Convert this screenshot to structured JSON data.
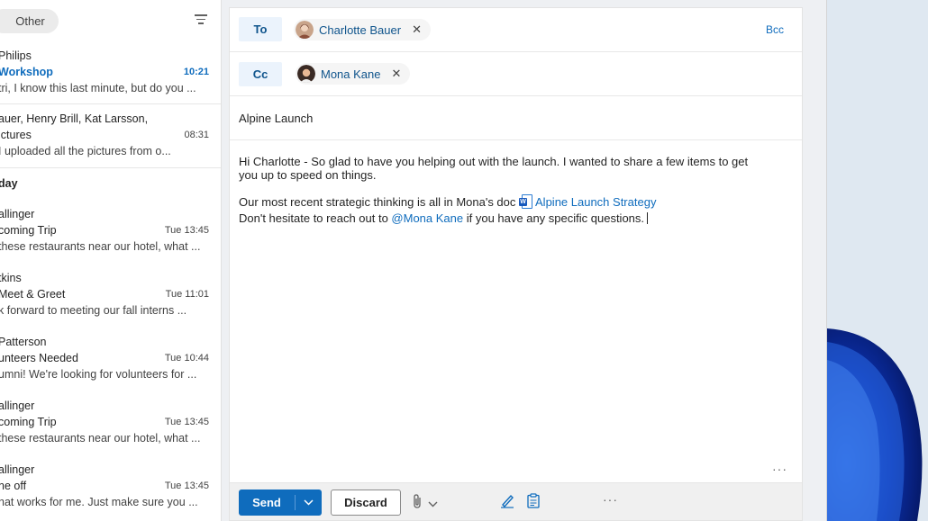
{
  "message_list": {
    "filter_tab": "Other",
    "group_header": "day",
    "messages": [
      {
        "sender": "Philips",
        "subject": "Workshop",
        "time": "10:21",
        "preview": "tri, I know this last minute, but do you ...",
        "unread": true
      },
      {
        "sender": "auer, Henry Brill, Kat Larsson,",
        "subject": "ictures",
        "time": "08:31",
        "preview": "I uploaded all the pictures from o...",
        "unread": false
      },
      {
        "sender": "allinger",
        "subject": "coming Trip",
        "time": "Tue 13:45",
        "preview": "these restaurants near our hotel, what ...",
        "unread": false
      },
      {
        "sender": "tkins",
        "subject": "Meet & Greet",
        "time": "Tue 11:01",
        "preview": "k forward to meeting our fall interns ...",
        "unread": false
      },
      {
        "sender": "Patterson",
        "subject": "unteers Needed",
        "time": "Tue 10:44",
        "preview": "umni! We're looking for volunteers for ...",
        "unread": false
      },
      {
        "sender": "allinger",
        "subject": "coming Trip",
        "time": "Tue 13:45",
        "preview": "these restaurants near our hotel, what ...",
        "unread": false
      },
      {
        "sender": "allinger",
        "subject": "ne off",
        "time": "Tue 13:45",
        "preview": "hat works for me. Just make sure you ...",
        "unread": false
      }
    ]
  },
  "compose": {
    "to_label": "To",
    "cc_label": "Cc",
    "bcc_label": "Bcc",
    "to_recipient": "Charlotte Bauer",
    "cc_recipient": "Mona Kane",
    "subject": "Alpine Launch",
    "body": {
      "para1": "Hi Charlotte - So glad to have you helping out with the launch. I wanted to share a few items to get you up to speed on things.",
      "para2_prefix": "Our most recent strategic thinking is all in Mona's doc ",
      "doc_link": "Alpine Launch Strategy",
      "para3_prefix": "Don't hesitate to reach out to ",
      "mention": "@Mona Kane",
      "para3_suffix": " if you have any specific questions."
    },
    "more_label": "···",
    "toolbar": {
      "send_label": "Send",
      "discard_label": "Discard",
      "more_label": "···"
    }
  },
  "colors": {
    "accent": "#0f6cbd",
    "pill_bg": "#ebebeb",
    "field_btn_bg": "#ebf3fc"
  }
}
